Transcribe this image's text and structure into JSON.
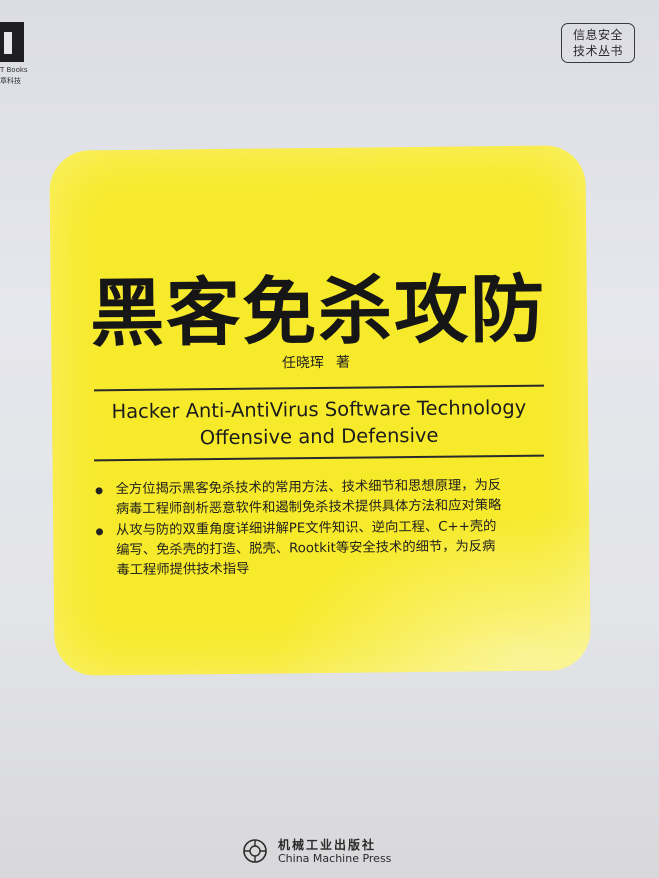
{
  "publisher_logo": {
    "line1": "T Books",
    "line2": "章科技"
  },
  "series_badge": {
    "line1": "信息安全",
    "line2": "技术丛书"
  },
  "book": {
    "title": "黑客免杀攻防",
    "author": "任晓珲",
    "author_role": "著",
    "english_title_line1": "Hacker Anti-AntiVirus Software Technology",
    "english_title_line2": "Offensive and Defensive"
  },
  "bullets": [
    {
      "lines": [
        "全方位揭示黑客免杀技术的常用方法、技术细节和思想原理，为反",
        "病毒工程师剖析恶意软件和遏制免杀技术提供具体方法和应对策略"
      ]
    },
    {
      "lines": [
        "从攻与防的双重角度详细讲解PE文件知识、逆向工程、C++壳的",
        "编写、免杀壳的打造、脱壳、Rootkit等安全技术的细节，为反病",
        "毒工程师提供技术指导"
      ]
    }
  ],
  "press": {
    "name_cn": "机械工业出版社",
    "name_en": "China Machine Press"
  },
  "colors": {
    "panel": "#f7ea2a",
    "background": "#e3e4e8",
    "text": "#161616"
  }
}
